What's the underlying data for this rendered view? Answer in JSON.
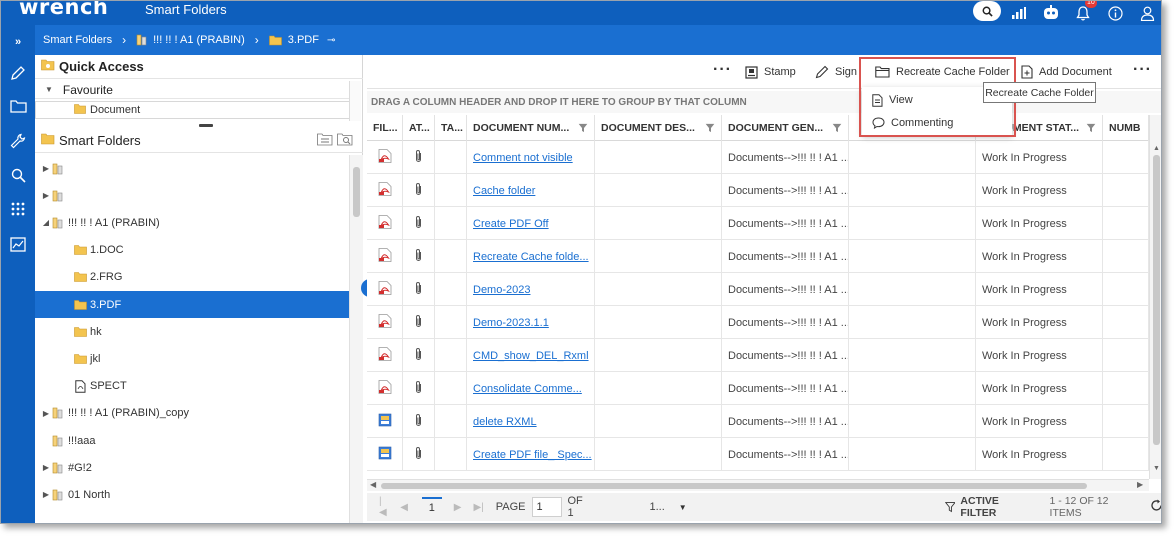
{
  "app": {
    "logo": "wrench",
    "title": "Smart Folders",
    "notification_count": "10"
  },
  "breadcrumb": [
    "Smart Folders",
    "!!! !! ! A1 (PRABIN)",
    "3.PDF"
  ],
  "left": {
    "quick_access": "Quick Access",
    "favourite": "Favourite",
    "favourite_item": "Document",
    "smart_folders": "Smart Folders",
    "tree": [
      {
        "label": "",
        "expander": "closed",
        "indent": 0,
        "icon": "db"
      },
      {
        "label": "",
        "expander": "closed",
        "indent": 0,
        "icon": "db"
      },
      {
        "label": "!!! !! ! A1 (PRABIN)",
        "expander": "open",
        "indent": 0,
        "icon": "db"
      },
      {
        "label": "1.DOC",
        "expander": "none",
        "indent": 1,
        "icon": "folder"
      },
      {
        "label": "2.FRG",
        "expander": "none",
        "indent": 1,
        "icon": "folder"
      },
      {
        "label": "3.PDF",
        "expander": "none",
        "indent": 1,
        "icon": "folder",
        "selected": true
      },
      {
        "label": "hk",
        "expander": "none",
        "indent": 1,
        "icon": "folder"
      },
      {
        "label": "jkl",
        "expander": "none",
        "indent": 1,
        "icon": "folder"
      },
      {
        "label": "SPECT",
        "expander": "none",
        "indent": 1,
        "icon": "pdf"
      },
      {
        "label": "!!! !! ! A1 (PRABIN)_copy",
        "expander": "closed",
        "indent": 0,
        "icon": "db"
      },
      {
        "label": "!!!aaa",
        "expander": "none",
        "indent": 0,
        "icon": "db"
      },
      {
        "label": "#G!2",
        "expander": "closed",
        "indent": 0,
        "icon": "db"
      },
      {
        "label": "01 North",
        "expander": "closed",
        "indent": 0,
        "icon": "db"
      }
    ]
  },
  "toolbar": {
    "stamp": "Stamp",
    "sign": "Sign",
    "recreate_cache": "Recreate Cache Folder",
    "add_document": "Add Document"
  },
  "dropdown": {
    "view": "View",
    "commenting": "Commenting"
  },
  "tooltip": "Recreate Cache Folder",
  "group_hint": "DRAG A COLUMN HEADER AND DROP IT HERE TO GROUP BY THAT COLUMN",
  "columns": [
    "FIL...",
    "AT...",
    "TA...",
    "DOCUMENT NUM...",
    "DOCUMENT DES...",
    "DOCUMENT GEN...",
    "",
    "DOCUMENT STAT...",
    "NUMB"
  ],
  "rows": [
    {
      "icon": "pdf",
      "name": "Comment not visible",
      "gen": "Documents-->!!! !! ! A1 ...",
      "status": "Work In Progress"
    },
    {
      "icon": "pdf",
      "name": "Cache folder",
      "gen": "Documents-->!!! !! ! A1 ...",
      "status": "Work In Progress"
    },
    {
      "icon": "pdf",
      "name": "Create PDF Off",
      "gen": "Documents-->!!! !! ! A1 ...",
      "status": "Work In Progress"
    },
    {
      "icon": "pdf",
      "name": "Recreate Cache folde...",
      "gen": "Documents-->!!! !! ! A1 ...",
      "status": "Work In Progress"
    },
    {
      "icon": "pdf",
      "name": "Demo-2023",
      "gen": "Documents-->!!! !! ! A1 ...",
      "status": "Work In Progress"
    },
    {
      "icon": "pdf",
      "name": "Demo-2023.1.1",
      "gen": "Documents-->!!! !! ! A1 ...",
      "status": "Work In Progress"
    },
    {
      "icon": "pdf",
      "name": "CMD_show_DEL_Rxml",
      "gen": "Documents-->!!! !! ! A1 ...",
      "status": "Work In Progress"
    },
    {
      "icon": "pdf",
      "name": "Consolidate Comme...",
      "gen": "Documents-->!!! !! ! A1 ...",
      "status": "Work In Progress"
    },
    {
      "icon": "img",
      "name": "delete RXML",
      "gen": "Documents-->!!! !! ! A1 ...",
      "status": "Work In Progress"
    },
    {
      "icon": "img",
      "name": "Create PDF file_ Spec...",
      "gen": "Documents-->!!! !! ! A1 ...",
      "status": "Work In Progress"
    }
  ],
  "pager": {
    "current": "1",
    "page_label": "PAGE",
    "page_value": "1",
    "of_label": "OF 1",
    "size": "1...",
    "filter": "ACTIVE FILTER",
    "items": "1 - 12 OF 12 ITEMS"
  },
  "colors": {
    "brand": "#0e5fbd",
    "accent": "#1a6fd1",
    "highlight": "#d9534f"
  }
}
